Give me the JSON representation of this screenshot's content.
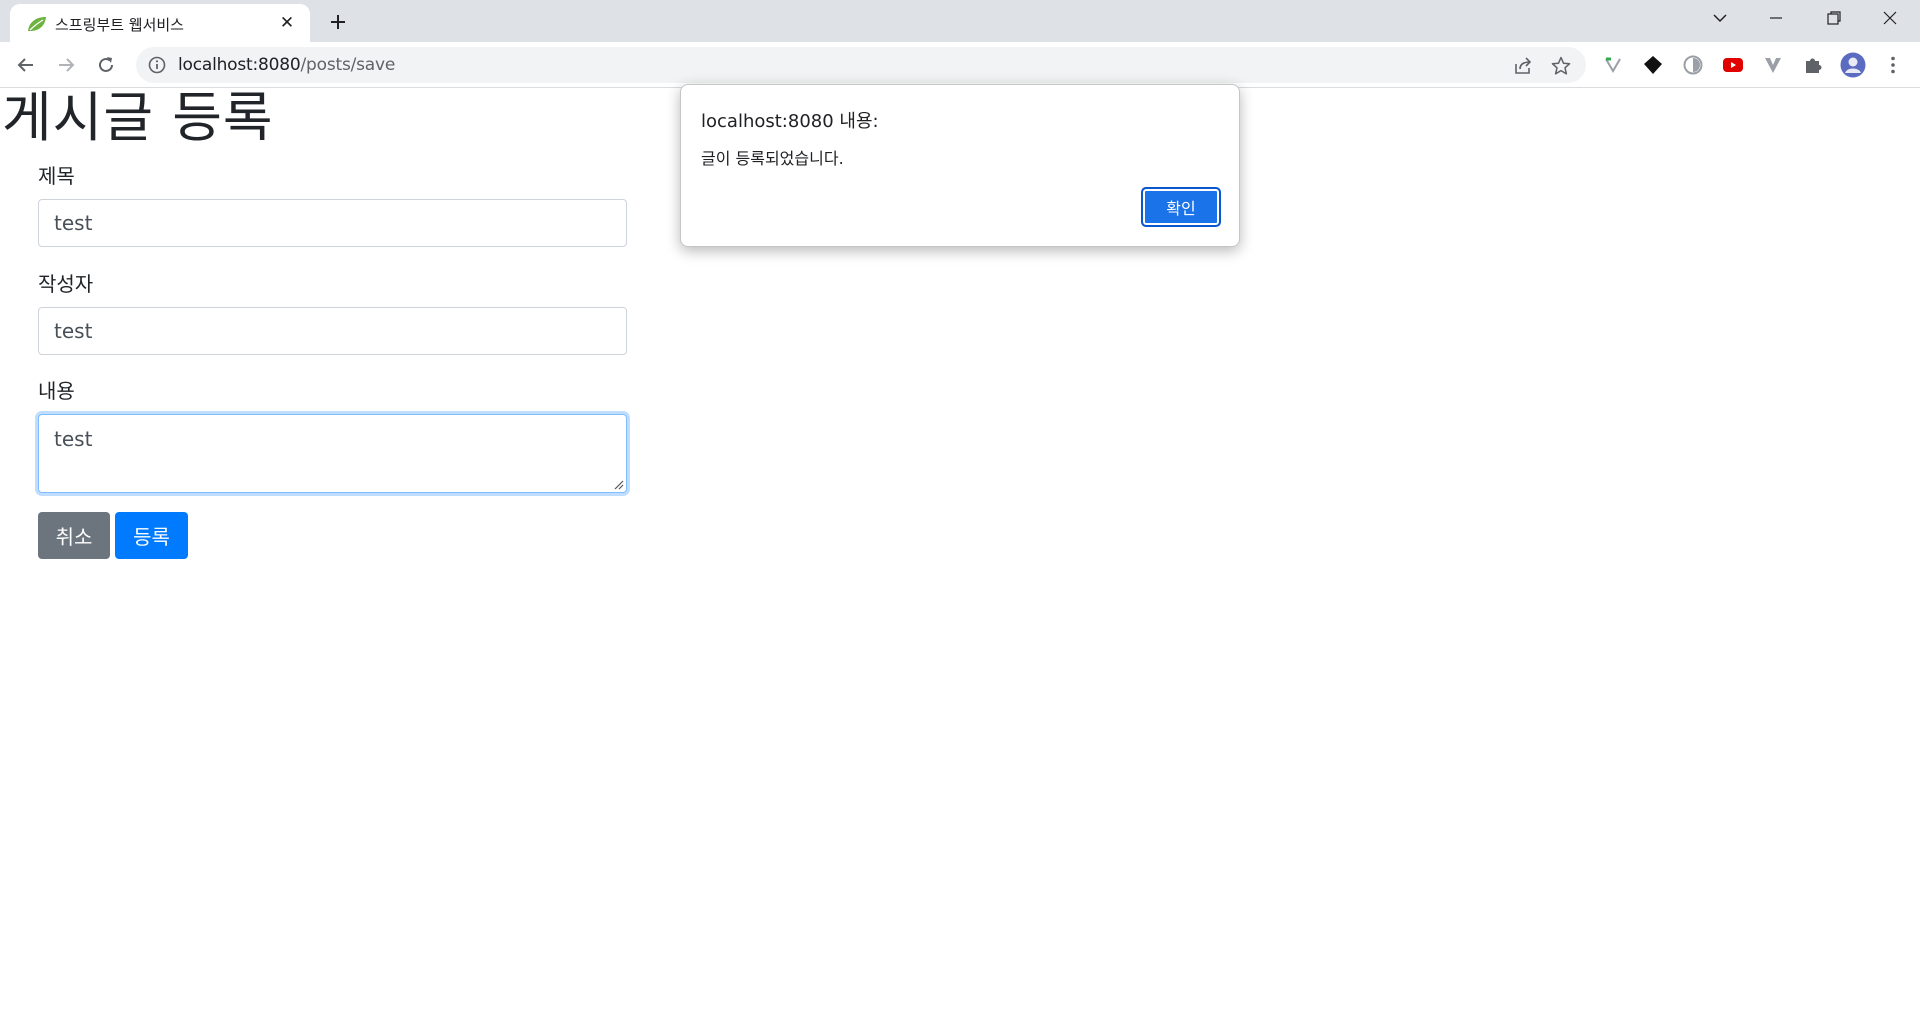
{
  "browser": {
    "tab_title": "스프링부트 웹서비스",
    "url_host": "localhost:8080",
    "url_path": "/posts/save"
  },
  "page": {
    "heading": "게시글 등록",
    "fields": {
      "title_label": "제목",
      "title_value": "test",
      "author_label": "작성자",
      "author_value": "test",
      "content_label": "내용",
      "content_value": "test"
    },
    "buttons": {
      "cancel": "취소",
      "submit": "등록"
    }
  },
  "dialog": {
    "title": "localhost:8080 내용:",
    "message": "글이 등록되었습니다.",
    "ok": "확인"
  },
  "colors": {
    "primary": "#007bff",
    "secondary": "#6c757d",
    "dialog_button": "#1a73e8"
  },
  "icons": {
    "favicon": "spring-leaf-icon",
    "omnibox": [
      "info-icon",
      "share-icon",
      "bookmark-star-icon"
    ],
    "extensions": [
      "extension-green-arrow-icon",
      "extension-black-diamond-icon",
      "extension-shield-icon",
      "extension-youtube-icon",
      "extension-v-icon",
      "puzzle-icon",
      "profile-avatar-icon",
      "kebab-menu-icon"
    ]
  }
}
